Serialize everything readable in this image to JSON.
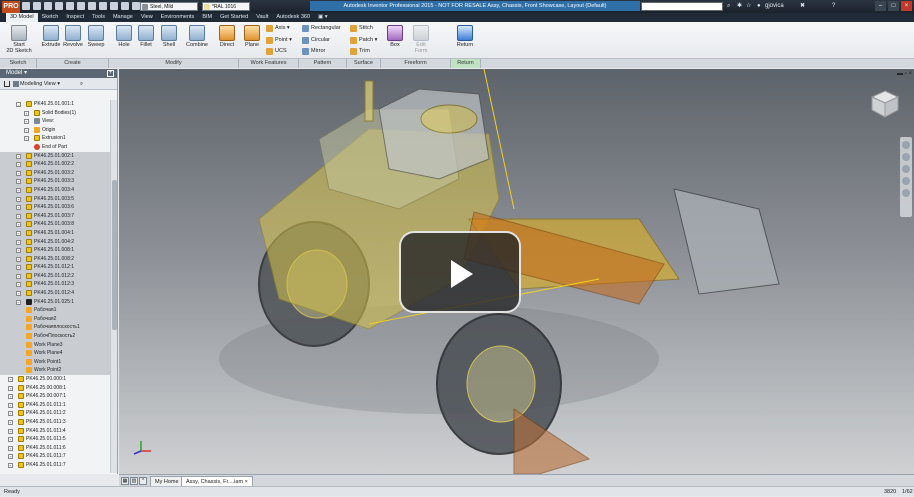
{
  "titlebar": {
    "app_button": "PRO",
    "style_value": "Steel, Mild",
    "color_value": "*RAL 1016",
    "title": "Autodesk Inventor Professional 2015 - NOT FOR RESALE   Assy, Chassis, Front Showcase, Layout (Default)",
    "user": "gjovica",
    "help": "?"
  },
  "tabs": [
    "3D Model",
    "Sketch",
    "Inspect",
    "Tools",
    "Manage",
    "View",
    "Environments",
    "BIM",
    "Get Started",
    "Vault",
    "Autodesk 360"
  ],
  "active_tab": "3D Model",
  "ribbon": {
    "start_sketch": "Start\n2D Sketch",
    "extrude": "Extrude",
    "revolve": "Revolve",
    "sweep": "Sweep",
    "hole": "Hole",
    "fillet": "Fillet",
    "shell": "Shell",
    "combine": "Combine",
    "direct": "Direct",
    "plane": "Plane",
    "axis": "Axis",
    "point": "Point",
    "ucs": "UCS",
    "rectangular": "Rectangular",
    "circular": "Circular",
    "mirror": "Mirror",
    "stitch": "Stitch",
    "patch": "Patch",
    "trim": "Trim",
    "box": "Box",
    "edit_form": "Edit\nForm",
    "return": "Return",
    "groups": [
      "Sketch",
      "Create",
      "Modify",
      "Work Features",
      "Pattern",
      "Surface",
      "Freeform",
      "Return"
    ]
  },
  "browser": {
    "header": "Model",
    "view": "Modeling View",
    "nodes": [
      {
        "label": "PK46.25.01.001:1",
        "indent": 26,
        "icon": "y",
        "expander": "-",
        "sel": false
      },
      {
        "label": "Solid Bodies(1)",
        "indent": 34,
        "icon": "y",
        "expander": "+",
        "sel": false
      },
      {
        "label": "View:",
        "indent": 34,
        "icon": "b",
        "expander": "+",
        "sel": false
      },
      {
        "label": "Origin",
        "indent": 34,
        "icon": "w",
        "expander": "+",
        "sel": false
      },
      {
        "label": "Extrusion1",
        "indent": 34,
        "icon": "y",
        "expander": "+",
        "sel": false
      },
      {
        "label": "End of Part",
        "indent": 34,
        "icon": "r",
        "expander": "",
        "sel": false
      },
      {
        "label": "PK46.25.01.002:1",
        "indent": 26,
        "icon": "y",
        "expander": "+",
        "sel": true
      },
      {
        "label": "PK46.25.01.002:2",
        "indent": 26,
        "icon": "y",
        "expander": "+",
        "sel": true
      },
      {
        "label": "PK46.25.01.003:2",
        "indent": 26,
        "icon": "y",
        "expander": "+",
        "sel": true
      },
      {
        "label": "PK46.25.01.003:3",
        "indent": 26,
        "icon": "y",
        "expander": "+",
        "sel": true
      },
      {
        "label": "PK46.25.01.003:4",
        "indent": 26,
        "icon": "y",
        "expander": "+",
        "sel": true
      },
      {
        "label": "PK46.25.01.003:5",
        "indent": 26,
        "icon": "y",
        "expander": "+",
        "sel": true
      },
      {
        "label": "PK46.25.01.003:6",
        "indent": 26,
        "icon": "y",
        "expander": "+",
        "sel": true
      },
      {
        "label": "PK46.25.01.003:7",
        "indent": 26,
        "icon": "y",
        "expander": "+",
        "sel": true
      },
      {
        "label": "PK46.25.01.003:8",
        "indent": 26,
        "icon": "y",
        "expander": "+",
        "sel": true
      },
      {
        "label": "PK46.25.01.004:1",
        "indent": 26,
        "icon": "y",
        "expander": "+",
        "sel": true
      },
      {
        "label": "PK46.25.01.004:2",
        "indent": 26,
        "icon": "y",
        "expander": "+",
        "sel": true
      },
      {
        "label": "PK46.25.01.008:1",
        "indent": 26,
        "icon": "y",
        "expander": "+",
        "sel": true
      },
      {
        "label": "PK46.25.01.008:2",
        "indent": 26,
        "icon": "y",
        "expander": "+",
        "sel": true
      },
      {
        "label": "PK46.25.01.012:1",
        "indent": 26,
        "icon": "y",
        "expander": "+",
        "sel": true
      },
      {
        "label": "PK46.25.01.012:2",
        "indent": 26,
        "icon": "y",
        "expander": "+",
        "sel": true
      },
      {
        "label": "PK46.25.01.012:3",
        "indent": 26,
        "icon": "y",
        "expander": "+",
        "sel": true
      },
      {
        "label": "PK46.25.01.012:4",
        "indent": 26,
        "icon": "y",
        "expander": "+",
        "sel": true
      },
      {
        "label": "PK46.25.01.025:1",
        "indent": 26,
        "icon": "k",
        "expander": "+",
        "sel": true
      },
      {
        "label": "Рабочая1",
        "indent": 26,
        "icon": "w",
        "expander": "",
        "sel": true
      },
      {
        "label": "Рабочая2",
        "indent": 26,
        "icon": "w",
        "expander": "",
        "sel": true
      },
      {
        "label": "Рабочаяплоскость1",
        "indent": 26,
        "icon": "w",
        "expander": "",
        "sel": true
      },
      {
        "label": "РабочПлоскость2",
        "indent": 26,
        "icon": "w",
        "expander": "",
        "sel": true
      },
      {
        "label": "Work Plane3",
        "indent": 26,
        "icon": "w",
        "expander": "",
        "sel": true
      },
      {
        "label": "Work Plane4",
        "indent": 26,
        "icon": "w",
        "expander": "",
        "sel": true
      },
      {
        "label": "Work Point1",
        "indent": 26,
        "icon": "w",
        "expander": "",
        "sel": true
      },
      {
        "label": "Work Point2",
        "indent": 26,
        "icon": "w",
        "expander": "",
        "sel": true
      },
      {
        "label": "PK46.25.00.000:1",
        "indent": 18,
        "icon": "y",
        "expander": "+",
        "sel": false
      },
      {
        "label": "PK46.25.00.008:1",
        "indent": 18,
        "icon": "y",
        "expander": "+",
        "sel": false
      },
      {
        "label": "PK46.25.00.007:1",
        "indent": 18,
        "icon": "y",
        "expander": "+",
        "sel": false
      },
      {
        "label": "PK46.25.01.011:1",
        "indent": 18,
        "icon": "y",
        "expander": "+",
        "sel": false
      },
      {
        "label": "PK46.25.01.011:2",
        "indent": 18,
        "icon": "y",
        "expander": "+",
        "sel": false
      },
      {
        "label": "PK46.25.01.011:3",
        "indent": 18,
        "icon": "y",
        "expander": "+",
        "sel": false
      },
      {
        "label": "PK46.25.01.011:4",
        "indent": 18,
        "icon": "y",
        "expander": "+",
        "sel": false
      },
      {
        "label": "PK46.25.01.011:5",
        "indent": 18,
        "icon": "y",
        "expander": "+",
        "sel": false
      },
      {
        "label": "PK46.25.01.011:6",
        "indent": 18,
        "icon": "y",
        "expander": "+",
        "sel": false
      },
      {
        "label": "PK46.25.01.011:7",
        "indent": 18,
        "icon": "y",
        "expander": "+",
        "sel": false
      },
      {
        "label": "PK46.25.01.011:7",
        "indent": 18,
        "icon": "y",
        "expander": "+",
        "sel": false
      }
    ]
  },
  "doctabs": {
    "home": "My Home",
    "doc": "Assy, Chassis, Fr....iam",
    "close": "×"
  },
  "status": {
    "left": "Ready",
    "num1": "3820",
    "num2": "1/62"
  },
  "colors": {
    "app_accent": "#c24b1b",
    "title_highlight": "#2f6fa8",
    "return_group": "#bfe3c2"
  }
}
